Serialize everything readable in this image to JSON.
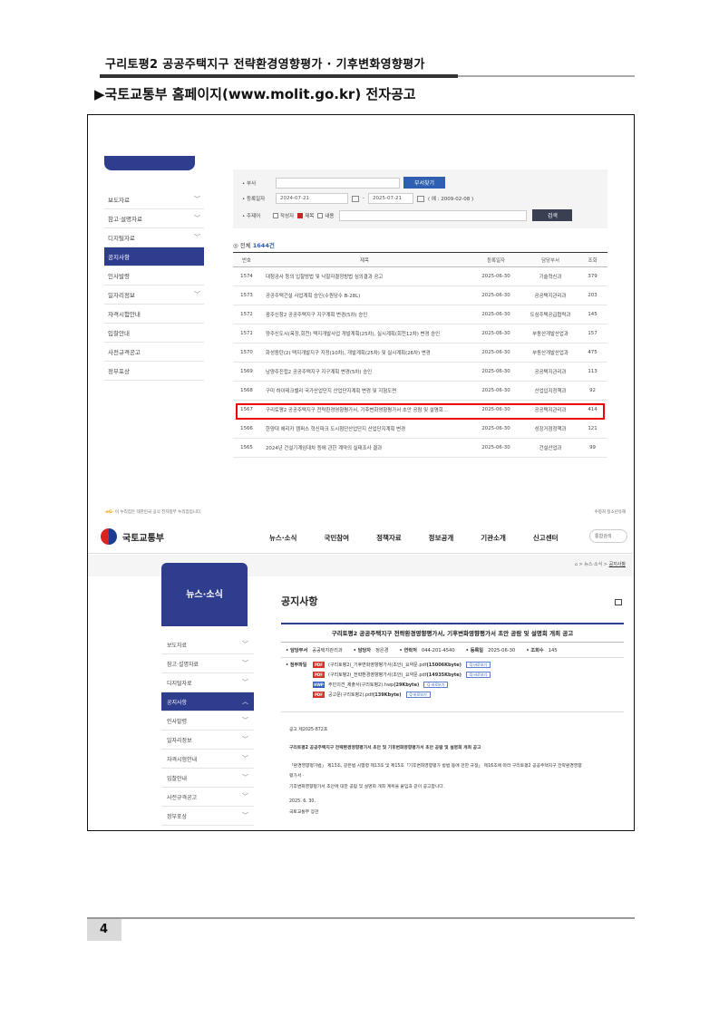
{
  "doc": {
    "header_title": "구리토평2 공공주택지구 전략환경영향평가 · 기후변화영향평가",
    "section_title": "▶국토교통부 홈페이지(www.molit.go.kr) 전자공고",
    "page_number": "4"
  },
  "list_page": {
    "sidebar": [
      {
        "label": "보도자료",
        "chev": true
      },
      {
        "label": "참고·설명자료",
        "chev": true
      },
      {
        "label": "디지털자료",
        "chev": true
      },
      {
        "label": "공지사항",
        "chev": false,
        "active": true
      },
      {
        "label": "인사발령",
        "chev": false
      },
      {
        "label": "일자리정보",
        "chev": true
      },
      {
        "label": "자격시험안내",
        "chev": false
      },
      {
        "label": "입찰안내",
        "chev": false
      },
      {
        "label": "사전규격공고",
        "chev": false
      },
      {
        "label": "정부포상",
        "chev": false
      }
    ],
    "search": {
      "dept_label": "• 부서",
      "dept_button": "부서찾기",
      "date_label": "• 등록일자",
      "date_from": "2024-07-21",
      "date_sep": "-",
      "date_to": "2025-07-21",
      "date_example": "( 예 : 2009-02-08 )",
      "subject_label": "• 주제어",
      "opt_author": "작성자",
      "opt_title": "제목",
      "opt_content": "내용",
      "search_button": "검색"
    },
    "total_prefix": "◎ 전체 ",
    "total_count": "1644건",
    "columns": [
      "번호",
      "제목",
      "등록일자",
      "담당부서",
      "조회"
    ],
    "rows": [
      {
        "no": "1574",
        "title": "대청공사 등의 입찰방법 및 낙찰자결정방법 심의결과 공고",
        "date": "2025-06-30",
        "dept": "기술혁신과",
        "views": "379"
      },
      {
        "no": "1573",
        "title": "공공주택건설 사업계획 승인(수원당수 B-28L)",
        "date": "2025-06-30",
        "dept": "공공택지관리과",
        "views": "203"
      },
      {
        "no": "1572",
        "title": "광주신창2 공공주택지구 지구계획 변경(5차) 승인",
        "date": "2025-06-30",
        "dept": "도심주택공급협력과",
        "views": "145"
      },
      {
        "no": "1571",
        "title": "양주신도시(옥정,회천) 택지개발사업 개발계획(25차), 실시계획(회천12차) 변경 승인",
        "date": "2025-06-30",
        "dept": "부동산개발산업과",
        "views": "157"
      },
      {
        "no": "1570",
        "title": "화성동탄(2) 택지개발지구 지정(10차), 개발계획(25차) 및 실시계획(26차) 변경",
        "date": "2025-06-30",
        "dept": "부동산개발산업과",
        "views": "475"
      },
      {
        "no": "1569",
        "title": "남양주진접2 공공주택지구 지구계획 변경(5차) 승인",
        "date": "2025-06-30",
        "dept": "공공택지관리과",
        "views": "113"
      },
      {
        "no": "1568",
        "title": "구미 하이테크밸리 국가산업단지 산업단지계획 변경 및 지형도면",
        "date": "2025-06-30",
        "dept": "산업입지정책과",
        "views": "92"
      },
      {
        "no": "1567",
        "title": "구리토평2 공공주택지구 전략환경영향평가서, 기후변화영향평가서 초안 공람 및 설명회...",
        "date": "2025-06-30",
        "dept": "공공택지관리과",
        "views": "414"
      },
      {
        "no": "1566",
        "title": "한양대 에리카 캠퍼스 혁신파크 도시첨단산업단지 산업단지계획 변경",
        "date": "2025-06-30",
        "dept": "성장거점정책과",
        "views": "121"
      },
      {
        "no": "1565",
        "title": "2024년 건설기계임대차 등에 관한 계약의 실태조사 결과",
        "date": "2025-06-30",
        "dept": "건설산업과",
        "views": "99"
      }
    ],
    "footer_left": "이 누리집은 대한민국 공식 전자정부 누리집입니다.",
    "footer_eg": "-eG-",
    "footer_right": "수정처 정소년유해"
  },
  "detail_page": {
    "logo_text": "국토교통부",
    "nav": [
      "뉴스·소식",
      "국민참여",
      "정책자료",
      "정보공개",
      "기관소개",
      "신고센터"
    ],
    "nav_search": "통합검색",
    "breadcrumb": "⌂ > 뉴스·소식 >",
    "breadcrumb_current": "공지사항",
    "side_heading": "뉴스·소식",
    "sidebar": [
      {
        "label": "보도자료",
        "chev": "﹀"
      },
      {
        "label": "참고·설명자료",
        "chev": "﹀"
      },
      {
        "label": "디지털자료",
        "chev": "﹀"
      },
      {
        "label": "공지사항",
        "chev": "︿",
        "active": true
      },
      {
        "label": "인사발령",
        "chev": "﹀"
      },
      {
        "label": "일자리정보",
        "chev": "﹀"
      },
      {
        "label": "자격시험안내",
        "chev": "﹀"
      },
      {
        "label": "입찰안내",
        "chev": "﹀"
      },
      {
        "label": "사전규격공고",
        "chev": "﹀"
      },
      {
        "label": "정부포상",
        "chev": "﹀"
      }
    ],
    "page_title": "공지사항",
    "post_title": "구리토평2 공공주택지구 전략환경영향평가서, 기후변화영향평가서 초안 공람 및 설명회 개최 공고",
    "meta": [
      {
        "label": "• 담당부서",
        "value": "공공택지관리과"
      },
      {
        "label": "• 담당자",
        "value": "정은경"
      },
      {
        "label": "• 연락처",
        "value": "044-201-4540"
      },
      {
        "label": "• 등록일",
        "value": "2025-06-30"
      },
      {
        "label": "• 조회수",
        "value": "145"
      }
    ],
    "attach_label": "• 첨부파일",
    "preview_label": "Q 바로보기",
    "attachments": [
      {
        "type": "PDF",
        "name": "(구리토평2)_기후변화영향평가서(초안)_요약문.pdf",
        "size": "(15006Kbyte)"
      },
      {
        "type": "PDF",
        "name": "(구리토평2)_전략환경영향평가서(초안)_요약문.pdf",
        "size": "(14935Kbyte)"
      },
      {
        "type": "HWP",
        "name": "주민의견_제출서(구리토평2).hwp",
        "size": "(29Kbyte)"
      },
      {
        "type": "PDF",
        "name": "공고문(구리토평2).pdf",
        "size": "(139Kbyte)"
      }
    ],
    "body_lines": [
      "공고 제2025-872호",
      "구리토평2 공공주택지구 전략환경영향평가서 초안 및 기후변화영향평가서 초안 공람 및 설명회 개최 공고",
      "「환경영향평가법」 제13조, 같은법 시행령 제13조 및 제15조「기후변화영향평가 방법 등에 관한 규정」 제16조에 따라 구리토평2 공공주택지구 전략환경영향",
      "평가서 ·",
      "기후변화영향평가서 초안에 대한 공람 및 설명회 개최 계획을 붙임과 같이 공고합니다.",
      "2025. 6. 30.",
      "국토교통부 장관"
    ]
  }
}
